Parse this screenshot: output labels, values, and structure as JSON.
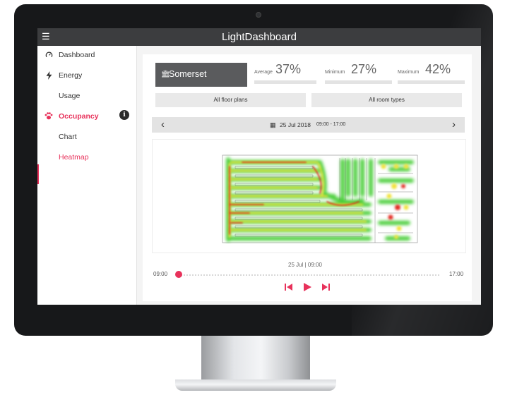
{
  "app": {
    "title": "LightDashboard"
  },
  "sidebar": {
    "items": [
      {
        "label": "Dashboard",
        "icon": "dashboard-icon"
      },
      {
        "label": "Energy",
        "icon": "lightning-icon"
      },
      {
        "label": "Usage"
      },
      {
        "label": "Occupancy",
        "icon": "paw-icon"
      },
      {
        "label": "Chart"
      },
      {
        "label": "Heatmap"
      }
    ],
    "info_badge": "i"
  },
  "site": {
    "name": "Somerset"
  },
  "stats": {
    "average": {
      "label": "Average",
      "value": "37%"
    },
    "minimum": {
      "label": "Minimum",
      "value": "27%"
    },
    "maximum": {
      "label": "Maximum",
      "value": "42%"
    }
  },
  "filters": {
    "floor_plans": "All floor plans",
    "room_types": "All room types"
  },
  "date_nav": {
    "date": "25 Jul 2018",
    "range": "09:00 - 17:00"
  },
  "timeline": {
    "current": "25 Jul | 09:00",
    "start": "09:00",
    "end": "17:00",
    "progress": 0
  },
  "colors": {
    "accent": "#e8325b",
    "topbar": "#3c3d3f",
    "site_box": "#5a5b5d"
  }
}
